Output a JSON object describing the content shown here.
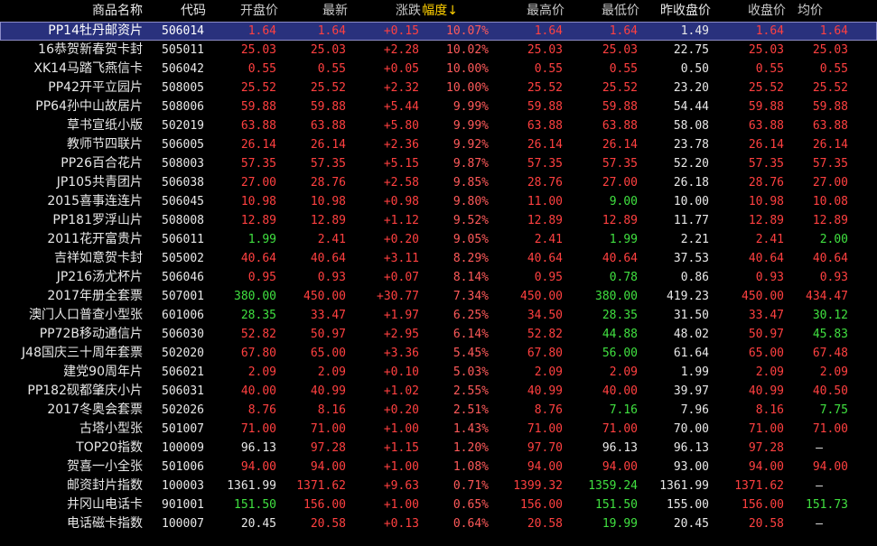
{
  "headers": {
    "name": "商品名称",
    "code": "代码",
    "open": "开盘价",
    "last": "最新",
    "change": "涨跌",
    "pct": "幅度↓",
    "high": "最高价",
    "low": "最低价",
    "prev_close": "昨收盘价",
    "close": "收盘价",
    "avg": "均价"
  },
  "sorted_column": "pct",
  "selected_row": 0,
  "colors": {
    "up": "#ff4040",
    "down": "#40e040",
    "flat": "#e8e8e8",
    "header_sorted": "#ffd000",
    "selected_bg": "#29317d"
  },
  "rows": [
    {
      "name": "PP14牡丹邮资片",
      "code": "506014",
      "open": "1.64",
      "open_c": "up",
      "last": "1.64",
      "last_c": "up",
      "chg": "+0.15",
      "pct": "10.07%",
      "high": "1.64",
      "high_c": "up",
      "low": "1.64",
      "low_c": "up",
      "prev": "1.49",
      "close": "1.64",
      "close_c": "up",
      "avg": "1.64",
      "avg_c": "up"
    },
    {
      "name": "16恭贺新春贺卡封",
      "code": "505011",
      "open": "25.03",
      "open_c": "up",
      "last": "25.03",
      "last_c": "up",
      "chg": "+2.28",
      "pct": "10.02%",
      "high": "25.03",
      "high_c": "up",
      "low": "25.03",
      "low_c": "up",
      "prev": "22.75",
      "close": "25.03",
      "close_c": "up",
      "avg": "25.03",
      "avg_c": "up"
    },
    {
      "name": "XK14马踏飞燕信卡",
      "code": "506042",
      "open": "0.55",
      "open_c": "up",
      "last": "0.55",
      "last_c": "up",
      "chg": "+0.05",
      "pct": "10.00%",
      "high": "0.55",
      "high_c": "up",
      "low": "0.55",
      "low_c": "up",
      "prev": "0.50",
      "close": "0.55",
      "close_c": "up",
      "avg": "0.55",
      "avg_c": "up"
    },
    {
      "name": "PP42开平立园片",
      "code": "508005",
      "open": "25.52",
      "open_c": "up",
      "last": "25.52",
      "last_c": "up",
      "chg": "+2.32",
      "pct": "10.00%",
      "high": "25.52",
      "high_c": "up",
      "low": "25.52",
      "low_c": "up",
      "prev": "23.20",
      "close": "25.52",
      "close_c": "up",
      "avg": "25.52",
      "avg_c": "up"
    },
    {
      "name": "PP64孙中山故居片",
      "code": "508006",
      "open": "59.88",
      "open_c": "up",
      "last": "59.88",
      "last_c": "up",
      "chg": "+5.44",
      "pct": "9.99%",
      "high": "59.88",
      "high_c": "up",
      "low": "59.88",
      "low_c": "up",
      "prev": "54.44",
      "close": "59.88",
      "close_c": "up",
      "avg": "59.88",
      "avg_c": "up"
    },
    {
      "name": "草书宣纸小版",
      "code": "502019",
      "open": "63.88",
      "open_c": "up",
      "last": "63.88",
      "last_c": "up",
      "chg": "+5.80",
      "pct": "9.99%",
      "high": "63.88",
      "high_c": "up",
      "low": "63.88",
      "low_c": "up",
      "prev": "58.08",
      "close": "63.88",
      "close_c": "up",
      "avg": "63.88",
      "avg_c": "up"
    },
    {
      "name": "教师节四联片",
      "code": "506005",
      "open": "26.14",
      "open_c": "up",
      "last": "26.14",
      "last_c": "up",
      "chg": "+2.36",
      "pct": "9.92%",
      "high": "26.14",
      "high_c": "up",
      "low": "26.14",
      "low_c": "up",
      "prev": "23.78",
      "close": "26.14",
      "close_c": "up",
      "avg": "26.14",
      "avg_c": "up"
    },
    {
      "name": "PP26百合花片",
      "code": "508003",
      "open": "57.35",
      "open_c": "up",
      "last": "57.35",
      "last_c": "up",
      "chg": "+5.15",
      "pct": "9.87%",
      "high": "57.35",
      "high_c": "up",
      "low": "57.35",
      "low_c": "up",
      "prev": "52.20",
      "close": "57.35",
      "close_c": "up",
      "avg": "57.35",
      "avg_c": "up"
    },
    {
      "name": "JP105共青团片",
      "code": "506038",
      "open": "27.00",
      "open_c": "up",
      "last": "28.76",
      "last_c": "up",
      "chg": "+2.58",
      "pct": "9.85%",
      "high": "28.76",
      "high_c": "up",
      "low": "27.00",
      "low_c": "up",
      "prev": "26.18",
      "close": "28.76",
      "close_c": "up",
      "avg": "27.00",
      "avg_c": "up"
    },
    {
      "name": "2015喜事连连片",
      "code": "506045",
      "open": "10.98",
      "open_c": "up",
      "last": "10.98",
      "last_c": "up",
      "chg": "+0.98",
      "pct": "9.80%",
      "high": "11.00",
      "high_c": "up",
      "low": "9.00",
      "low_c": "down",
      "prev": "10.00",
      "close": "10.98",
      "close_c": "up",
      "avg": "10.08",
      "avg_c": "up"
    },
    {
      "name": "PP181罗浮山片",
      "code": "508008",
      "open": "12.89",
      "open_c": "up",
      "last": "12.89",
      "last_c": "up",
      "chg": "+1.12",
      "pct": "9.52%",
      "high": "12.89",
      "high_c": "up",
      "low": "12.89",
      "low_c": "up",
      "prev": "11.77",
      "close": "12.89",
      "close_c": "up",
      "avg": "12.89",
      "avg_c": "up"
    },
    {
      "name": "2011花开富贵片",
      "code": "506011",
      "open": "1.99",
      "open_c": "down",
      "last": "2.41",
      "last_c": "up",
      "chg": "+0.20",
      "pct": "9.05%",
      "high": "2.41",
      "high_c": "up",
      "low": "1.99",
      "low_c": "down",
      "prev": "2.21",
      "close": "2.41",
      "close_c": "up",
      "avg": "2.00",
      "avg_c": "down"
    },
    {
      "name": "吉祥如意贺卡封",
      "code": "505002",
      "open": "40.64",
      "open_c": "up",
      "last": "40.64",
      "last_c": "up",
      "chg": "+3.11",
      "pct": "8.29%",
      "high": "40.64",
      "high_c": "up",
      "low": "40.64",
      "low_c": "up",
      "prev": "37.53",
      "close": "40.64",
      "close_c": "up",
      "avg": "40.64",
      "avg_c": "up"
    },
    {
      "name": "JP216汤尤杯片",
      "code": "506046",
      "open": "0.95",
      "open_c": "up",
      "last": "0.93",
      "last_c": "up",
      "chg": "+0.07",
      "pct": "8.14%",
      "high": "0.95",
      "high_c": "up",
      "low": "0.78",
      "low_c": "down",
      "prev": "0.86",
      "close": "0.93",
      "close_c": "up",
      "avg": "0.93",
      "avg_c": "up"
    },
    {
      "name": "2017年册全套票",
      "code": "507001",
      "open": "380.00",
      "open_c": "down",
      "last": "450.00",
      "last_c": "up",
      "chg": "+30.77",
      "pct": "7.34%",
      "high": "450.00",
      "high_c": "up",
      "low": "380.00",
      "low_c": "down",
      "prev": "419.23",
      "close": "450.00",
      "close_c": "up",
      "avg": "434.47",
      "avg_c": "up"
    },
    {
      "name": "澳门人口普查小型张",
      "code": "601006",
      "open": "28.35",
      "open_c": "down",
      "last": "33.47",
      "last_c": "up",
      "chg": "+1.97",
      "pct": "6.25%",
      "high": "34.50",
      "high_c": "up",
      "low": "28.35",
      "low_c": "down",
      "prev": "31.50",
      "close": "33.47",
      "close_c": "up",
      "avg": "30.12",
      "avg_c": "down"
    },
    {
      "name": "PP72B移动通信片",
      "code": "506030",
      "open": "52.82",
      "open_c": "up",
      "last": "50.97",
      "last_c": "up",
      "chg": "+2.95",
      "pct": "6.14%",
      "high": "52.82",
      "high_c": "up",
      "low": "44.88",
      "low_c": "down",
      "prev": "48.02",
      "close": "50.97",
      "close_c": "up",
      "avg": "45.83",
      "avg_c": "down"
    },
    {
      "name": "J48国庆三十周年套票",
      "code": "502020",
      "open": "67.80",
      "open_c": "up",
      "last": "65.00",
      "last_c": "up",
      "chg": "+3.36",
      "pct": "5.45%",
      "high": "67.80",
      "high_c": "up",
      "low": "56.00",
      "low_c": "down",
      "prev": "61.64",
      "close": "65.00",
      "close_c": "up",
      "avg": "67.48",
      "avg_c": "up"
    },
    {
      "name": "建党90周年片",
      "code": "506021",
      "open": "2.09",
      "open_c": "up",
      "last": "2.09",
      "last_c": "up",
      "chg": "+0.10",
      "pct": "5.03%",
      "high": "2.09",
      "high_c": "up",
      "low": "2.09",
      "low_c": "up",
      "prev": "1.99",
      "close": "2.09",
      "close_c": "up",
      "avg": "2.09",
      "avg_c": "up"
    },
    {
      "name": "PP182砚都肇庆小片",
      "code": "506031",
      "open": "40.00",
      "open_c": "up",
      "last": "40.99",
      "last_c": "up",
      "chg": "+1.02",
      "pct": "2.55%",
      "high": "40.99",
      "high_c": "up",
      "low": "40.00",
      "low_c": "up",
      "prev": "39.97",
      "close": "40.99",
      "close_c": "up",
      "avg": "40.50",
      "avg_c": "up"
    },
    {
      "name": "2017冬奥会套票",
      "code": "502026",
      "open": "8.76",
      "open_c": "up",
      "last": "8.16",
      "last_c": "up",
      "chg": "+0.20",
      "pct": "2.51%",
      "high": "8.76",
      "high_c": "up",
      "low": "7.16",
      "low_c": "down",
      "prev": "7.96",
      "close": "8.16",
      "close_c": "up",
      "avg": "7.75",
      "avg_c": "down"
    },
    {
      "name": "古塔小型张",
      "code": "501007",
      "open": "71.00",
      "open_c": "up",
      "last": "71.00",
      "last_c": "up",
      "chg": "+1.00",
      "pct": "1.43%",
      "high": "71.00",
      "high_c": "up",
      "low": "71.00",
      "low_c": "up",
      "prev": "70.00",
      "close": "71.00",
      "close_c": "up",
      "avg": "71.00",
      "avg_c": "up"
    },
    {
      "name": "TOP20指数",
      "code": "100009",
      "open": "96.13",
      "open_c": "flat",
      "last": "97.28",
      "last_c": "up",
      "chg": "+1.15",
      "pct": "1.20%",
      "high": "97.70",
      "high_c": "up",
      "low": "96.13",
      "low_c": "flat",
      "prev": "96.13",
      "close": "97.28",
      "close_c": "up",
      "avg": "—",
      "avg_c": "flat"
    },
    {
      "name": "贺喜一小全张",
      "code": "501006",
      "open": "94.00",
      "open_c": "up",
      "last": "94.00",
      "last_c": "up",
      "chg": "+1.00",
      "pct": "1.08%",
      "high": "94.00",
      "high_c": "up",
      "low": "94.00",
      "low_c": "up",
      "prev": "93.00",
      "close": "94.00",
      "close_c": "up",
      "avg": "94.00",
      "avg_c": "up"
    },
    {
      "name": "邮资封片指数",
      "code": "100003",
      "open": "1361.99",
      "open_c": "flat",
      "last": "1371.62",
      "last_c": "up",
      "chg": "+9.63",
      "pct": "0.71%",
      "high": "1399.32",
      "high_c": "up",
      "low": "1359.24",
      "low_c": "down",
      "prev": "1361.99",
      "close": "1371.62",
      "close_c": "up",
      "avg": "—",
      "avg_c": "flat"
    },
    {
      "name": "井冈山电话卡",
      "code": "901001",
      "open": "151.50",
      "open_c": "down",
      "last": "156.00",
      "last_c": "up",
      "chg": "+1.00",
      "pct": "0.65%",
      "high": "156.00",
      "high_c": "up",
      "low": "151.50",
      "low_c": "down",
      "prev": "155.00",
      "close": "156.00",
      "close_c": "up",
      "avg": "151.73",
      "avg_c": "down"
    },
    {
      "name": "电话磁卡指数",
      "code": "100007",
      "open": "20.45",
      "open_c": "flat",
      "last": "20.58",
      "last_c": "up",
      "chg": "+0.13",
      "pct": "0.64%",
      "high": "20.58",
      "high_c": "up",
      "low": "19.99",
      "low_c": "down",
      "prev": "20.45",
      "close": "20.58",
      "close_c": "up",
      "avg": "—",
      "avg_c": "flat"
    }
  ]
}
